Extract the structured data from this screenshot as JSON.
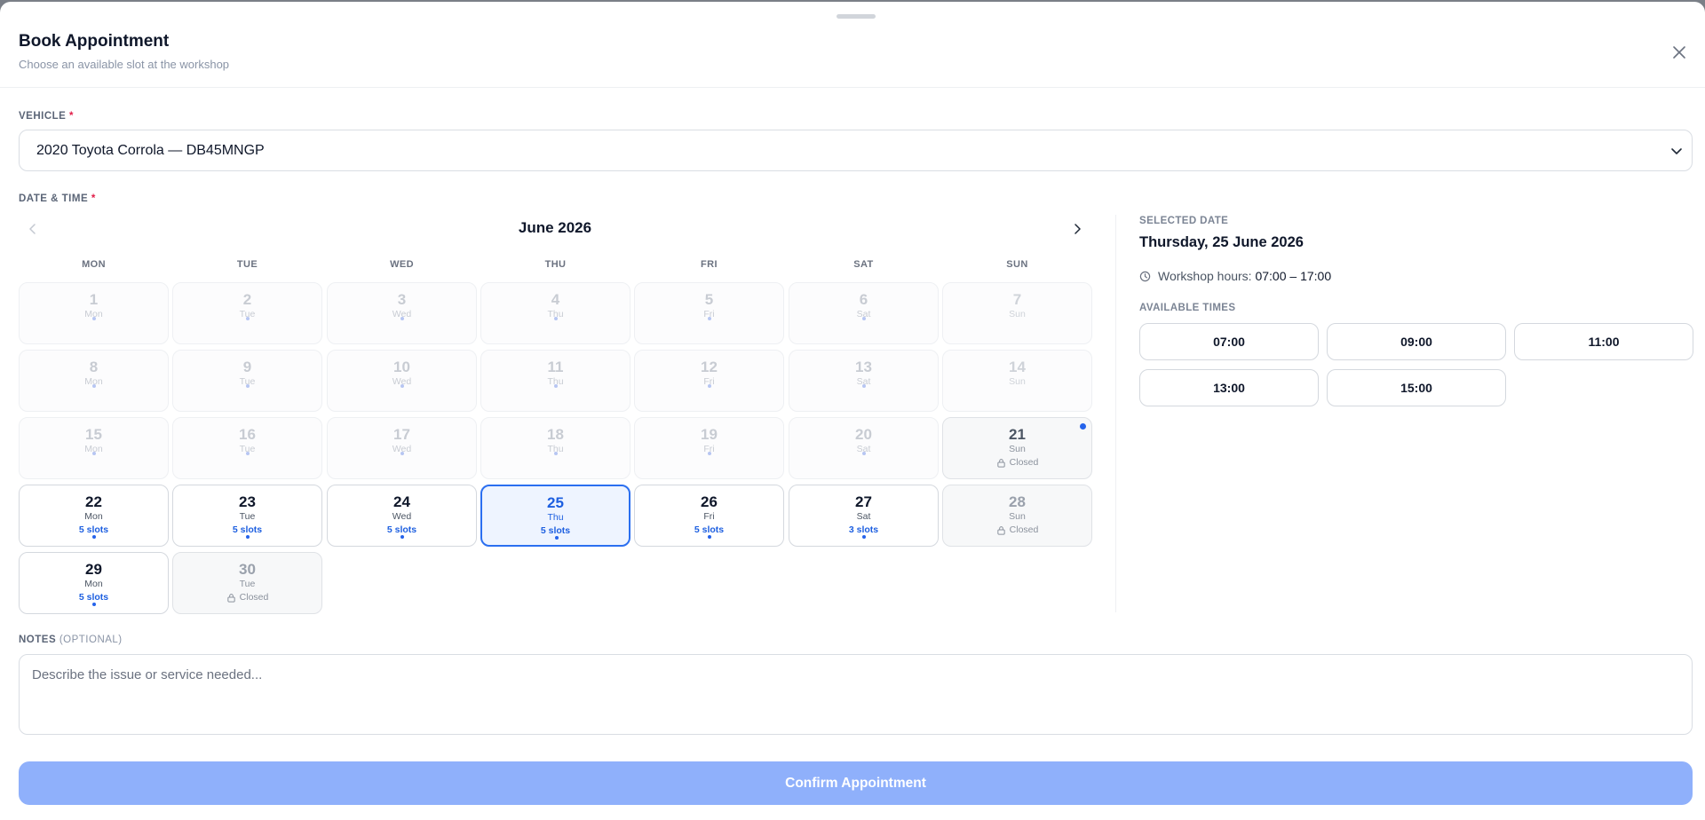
{
  "modal": {
    "title": "Book Appointment",
    "subtitle": "Choose an available slot at the workshop"
  },
  "vehicle": {
    "label": "VEHICLE",
    "required_mark": "*",
    "selected": "2020 Toyota Corrola — DB45MNGP"
  },
  "datetime": {
    "label": "DATE & TIME",
    "required_mark": "*"
  },
  "calendar": {
    "month_label": "June 2026",
    "weekdays": [
      "MON",
      "TUE",
      "WED",
      "THU",
      "FRI",
      "SAT",
      "SUN"
    ],
    "days": [
      {
        "num": "1",
        "wd": "Mon",
        "state": "past"
      },
      {
        "num": "2",
        "wd": "Tue",
        "state": "past"
      },
      {
        "num": "3",
        "wd": "Wed",
        "state": "past"
      },
      {
        "num": "4",
        "wd": "Thu",
        "state": "past"
      },
      {
        "num": "5",
        "wd": "Fri",
        "state": "past"
      },
      {
        "num": "6",
        "wd": "Sat",
        "state": "past"
      },
      {
        "num": "7",
        "wd": "Sun",
        "state": "past-sunday"
      },
      {
        "num": "8",
        "wd": "Mon",
        "state": "past"
      },
      {
        "num": "9",
        "wd": "Tue",
        "state": "past"
      },
      {
        "num": "10",
        "wd": "Wed",
        "state": "past"
      },
      {
        "num": "11",
        "wd": "Thu",
        "state": "past"
      },
      {
        "num": "12",
        "wd": "Fri",
        "state": "past"
      },
      {
        "num": "13",
        "wd": "Sat",
        "state": "past"
      },
      {
        "num": "14",
        "wd": "Sun",
        "state": "past-sunday"
      },
      {
        "num": "15",
        "wd": "Mon",
        "state": "past"
      },
      {
        "num": "16",
        "wd": "Tue",
        "state": "past"
      },
      {
        "num": "17",
        "wd": "Wed",
        "state": "past"
      },
      {
        "num": "18",
        "wd": "Thu",
        "state": "past"
      },
      {
        "num": "19",
        "wd": "Fri",
        "state": "past"
      },
      {
        "num": "20",
        "wd": "Sat",
        "state": "past"
      },
      {
        "num": "21",
        "wd": "Sun",
        "state": "closed-today",
        "sub": "Closed"
      },
      {
        "num": "22",
        "wd": "Mon",
        "state": "open",
        "sub": "5 slots"
      },
      {
        "num": "23",
        "wd": "Tue",
        "state": "open",
        "sub": "5 slots"
      },
      {
        "num": "24",
        "wd": "Wed",
        "state": "open",
        "sub": "5 slots"
      },
      {
        "num": "25",
        "wd": "Thu",
        "state": "selected",
        "sub": "5 slots"
      },
      {
        "num": "26",
        "wd": "Fri",
        "state": "open",
        "sub": "5 slots"
      },
      {
        "num": "27",
        "wd": "Sat",
        "state": "open",
        "sub": "3 slots"
      },
      {
        "num": "28",
        "wd": "Sun",
        "state": "closed",
        "sub": "Closed"
      },
      {
        "num": "29",
        "wd": "Mon",
        "state": "open",
        "sub": "5 slots"
      },
      {
        "num": "30",
        "wd": "Tue",
        "state": "closed",
        "sub": "Closed"
      }
    ]
  },
  "selection": {
    "label": "SELECTED DATE",
    "date": "Thursday, 25 June 2026",
    "hours_prefix": "Workshop hours:",
    "hours_value": "07:00 – 17:00",
    "times_label": "AVAILABLE TIMES",
    "times": [
      "07:00",
      "09:00",
      "11:00",
      "13:00",
      "15:00"
    ]
  },
  "notes": {
    "label": "NOTES",
    "optional": "(OPTIONAL)",
    "placeholder": "Describe the issue or service needed..."
  },
  "confirm_label": "Confirm Appointment",
  "colors": {
    "accent": "#2563eb",
    "confirm_disabled": "#8fb0fb",
    "required": "#e11d48"
  }
}
